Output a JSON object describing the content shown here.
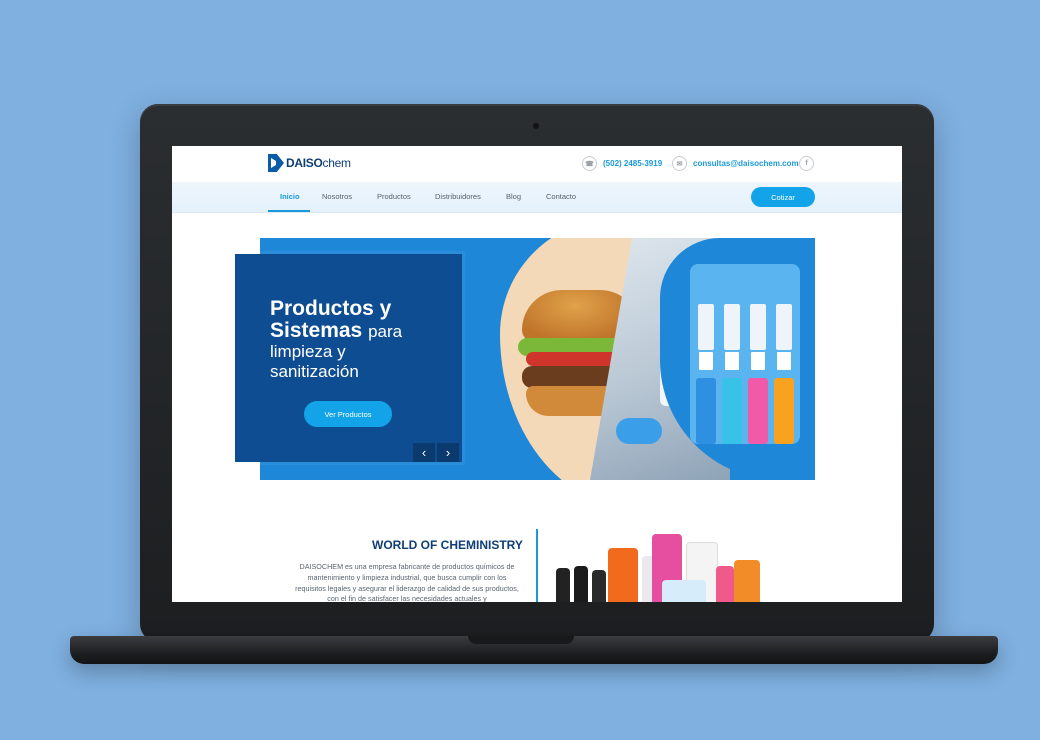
{
  "site": {
    "logo_bold": "DAISO",
    "logo_light": "chem",
    "phone": "(502) 2485-3919",
    "email": "consultas@daisochem.com",
    "facebook_glyph": "f"
  },
  "nav": {
    "items": [
      "Inicio",
      "Nosotros",
      "Productos",
      "Distribuidores",
      "Blog",
      "Contacto"
    ],
    "active": "Inicio",
    "cta": "Cotizar"
  },
  "hero": {
    "line1": "Productos y",
    "line2_bold": "Sistemas",
    "line2_rest": "para",
    "line3": "limpieza y",
    "line4": "sanitización",
    "button": "Ver Productos",
    "prev_glyph": "‹",
    "next_glyph": "›"
  },
  "about": {
    "title": "WORLD OF CHEMINISTRY",
    "text": "DAISOCHEM es una empresa fabricante de productos químicos de mantenimiento y limpieza industrial, que busca cumplir con los requisitos legales y asegurar el liderazgo de calidad de sus productos, con el fin de satisfacer las necesidades actuales y"
  },
  "colors": {
    "accent": "#12a3e8",
    "brand_dark": "#0e4d92",
    "background": "#7fb0e0"
  },
  "icons": {
    "phone": "phone-icon",
    "email": "mail-icon",
    "social": "facebook-icon",
    "prev": "chevron-left-icon",
    "next": "chevron-right-icon"
  }
}
